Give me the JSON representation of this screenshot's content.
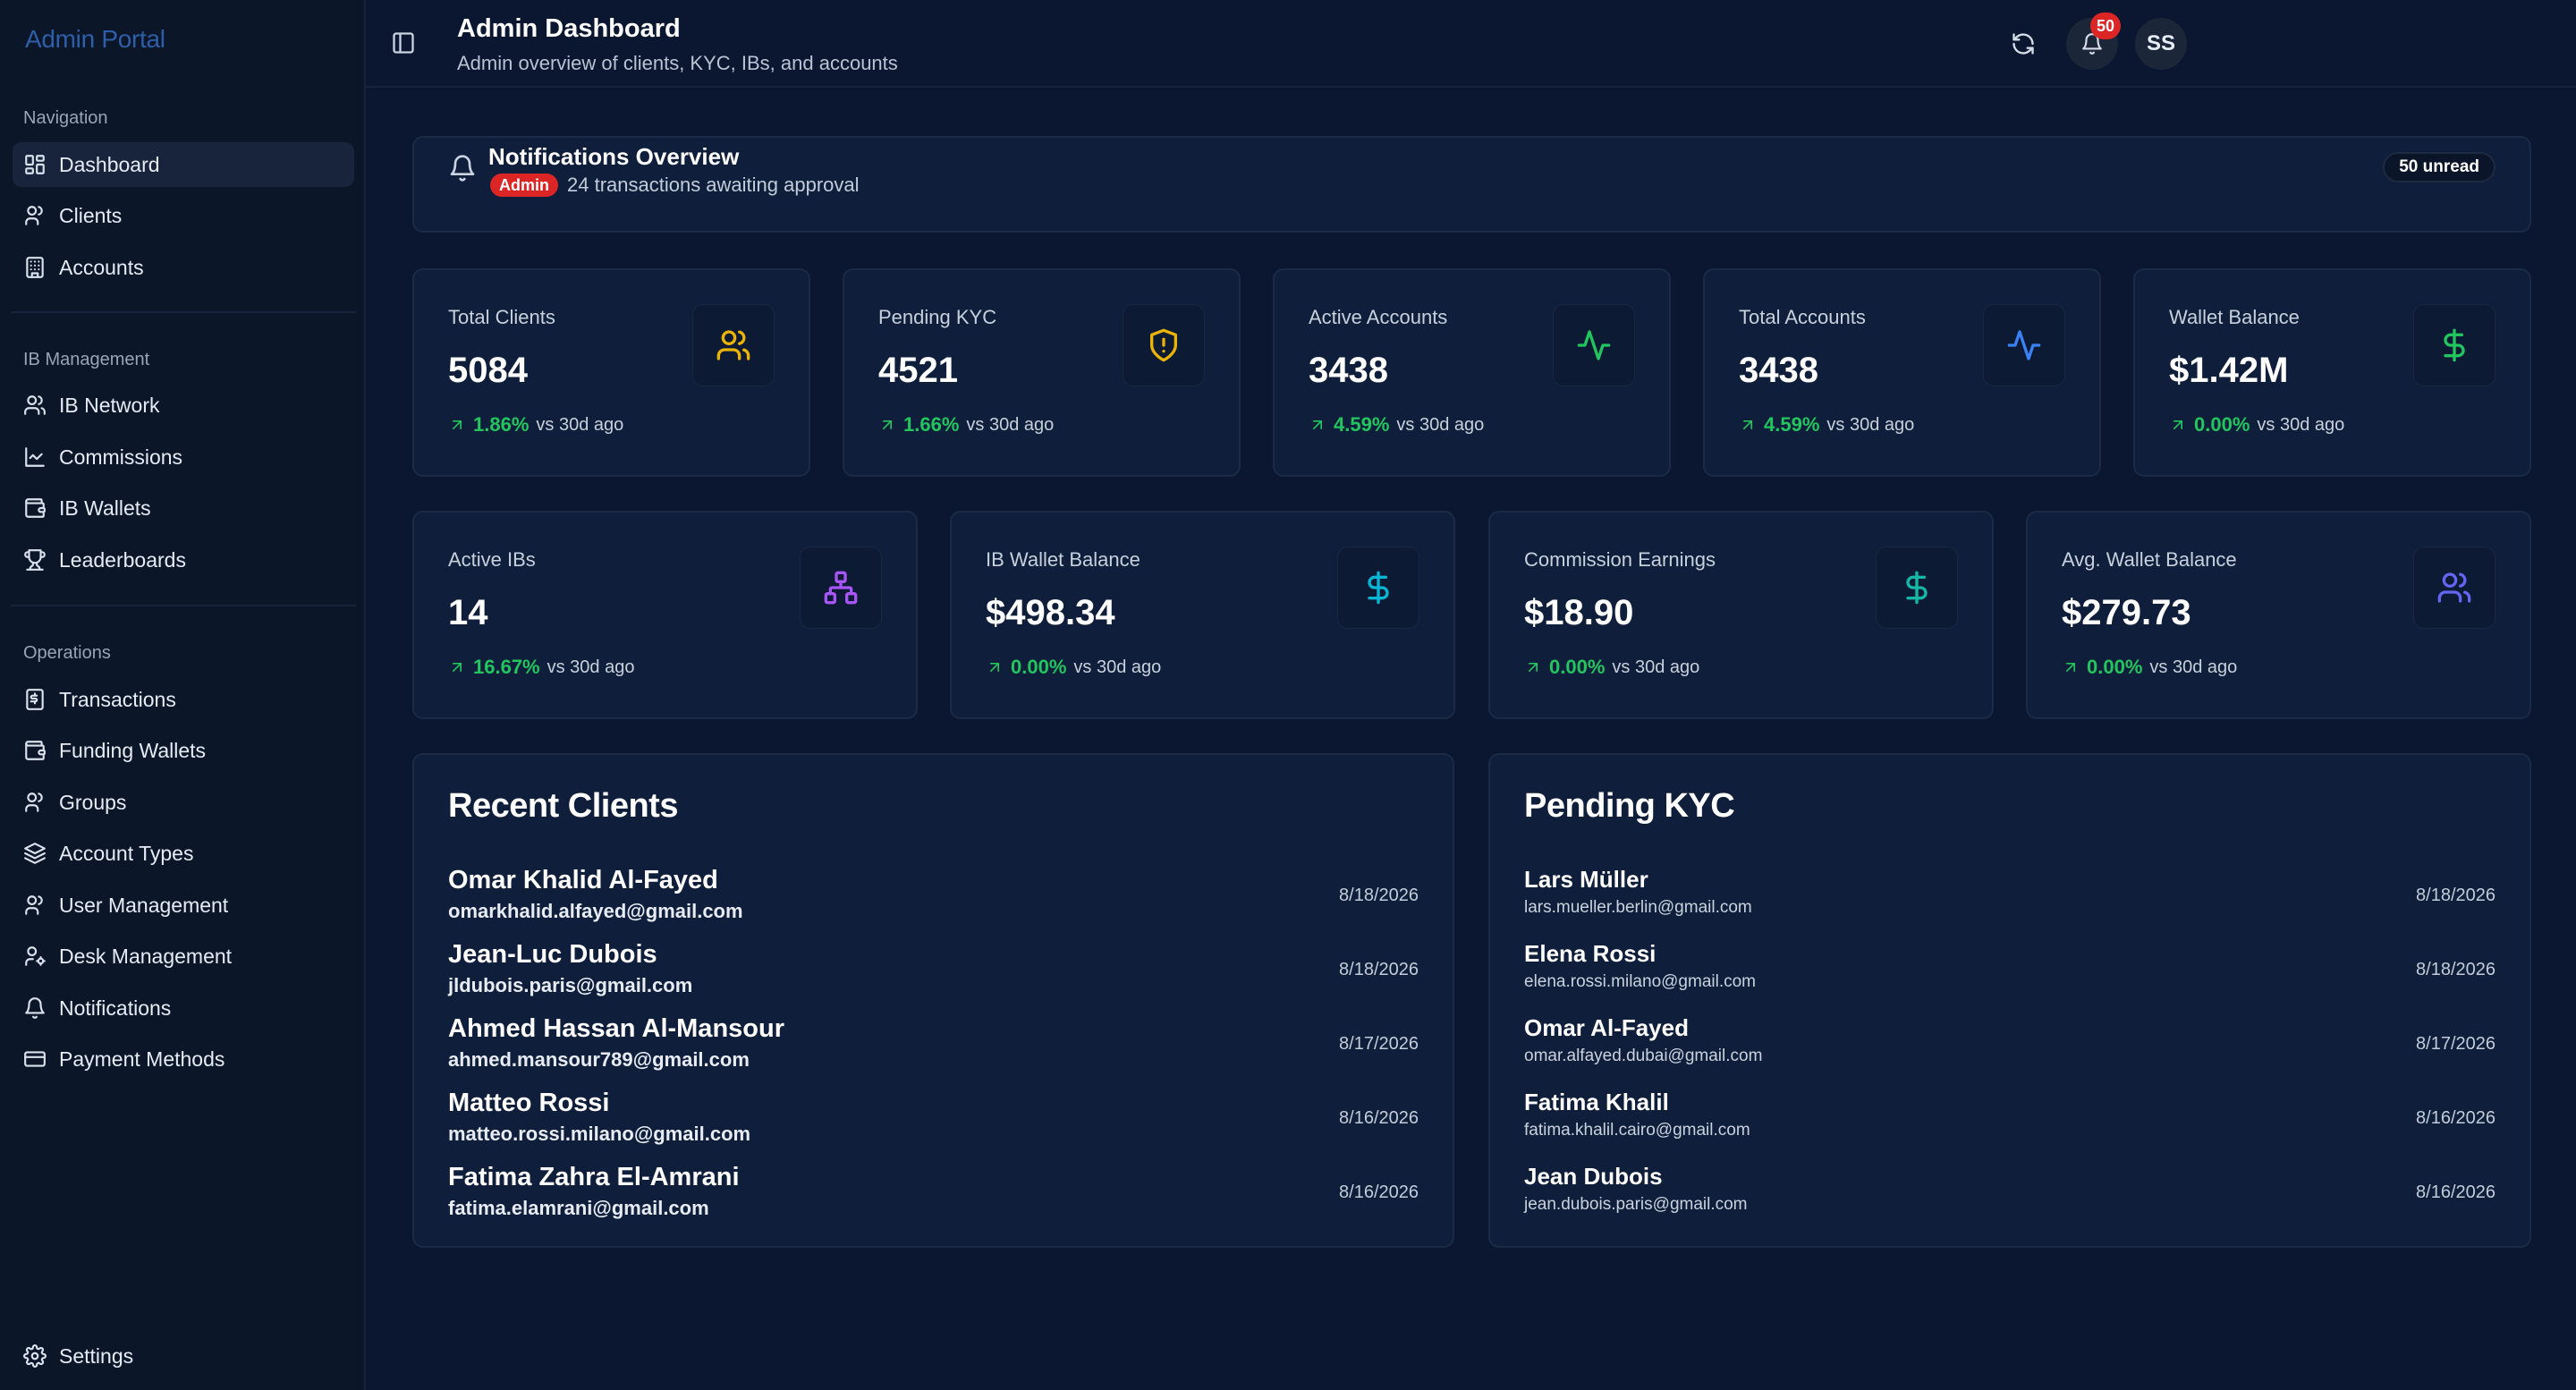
{
  "app": {
    "brand": "Admin Portal"
  },
  "header": {
    "title": "Admin Dashboard",
    "subtitle": "Admin overview of clients, KYC, IBs, and accounts",
    "notification_count": "50",
    "avatar_initials": "SS"
  },
  "sidebar": {
    "sections": [
      {
        "title": "Navigation",
        "items": [
          {
            "label": "Dashboard",
            "icon": "dashboard-icon",
            "active": true
          },
          {
            "label": "Clients",
            "icon": "user-icon"
          },
          {
            "label": "Accounts",
            "icon": "building-icon"
          }
        ]
      },
      {
        "title": "IB Management",
        "items": [
          {
            "label": "IB Network",
            "icon": "users-icon"
          },
          {
            "label": "Commissions",
            "icon": "chart-line-icon"
          },
          {
            "label": "IB Wallets",
            "icon": "wallet-icon"
          },
          {
            "label": "Leaderboards",
            "icon": "trophy-icon"
          }
        ]
      },
      {
        "title": "Operations",
        "items": [
          {
            "label": "Transactions",
            "icon": "receipt-icon"
          },
          {
            "label": "Funding Wallets",
            "icon": "wallet-icon"
          },
          {
            "label": "Groups",
            "icon": "user-icon"
          },
          {
            "label": "Account Types",
            "icon": "layers-icon"
          },
          {
            "label": "User Management",
            "icon": "user-icon"
          },
          {
            "label": "Desk Management",
            "icon": "user-cog-icon"
          },
          {
            "label": "Notifications",
            "icon": "bell-icon"
          },
          {
            "label": "Payment Methods",
            "icon": "credit-card-icon"
          }
        ]
      }
    ],
    "footer_item": {
      "label": "Settings",
      "icon": "gear-icon"
    }
  },
  "notifications": {
    "title": "Notifications Overview",
    "role_tag": "Admin",
    "message": "24 transactions awaiting approval",
    "unread": "50 unread"
  },
  "stats_row1": [
    {
      "label": "Total Clients",
      "value": "5084",
      "change": "1.86%",
      "period": "vs 30d ago",
      "icon": "users-icon",
      "color": "#eab308"
    },
    {
      "label": "Pending KYC",
      "value": "4521",
      "change": "1.66%",
      "period": "vs 30d ago",
      "icon": "shield-alert-icon",
      "color": "#eab308"
    },
    {
      "label": "Active Accounts",
      "value": "3438",
      "change": "4.59%",
      "period": "vs 30d ago",
      "icon": "activity-icon",
      "color": "#22c55e"
    },
    {
      "label": "Total Accounts",
      "value": "3438",
      "change": "4.59%",
      "period": "vs 30d ago",
      "icon": "activity-icon",
      "color": "#3b82f6"
    },
    {
      "label": "Wallet Balance",
      "value": "$1.42M",
      "change": "0.00%",
      "period": "vs 30d ago",
      "icon": "dollar-icon",
      "color": "#22c55e"
    }
  ],
  "stats_row2": [
    {
      "label": "Active IBs",
      "value": "14",
      "change": "16.67%",
      "period": "vs 30d ago",
      "icon": "network-icon",
      "color": "#a855f7"
    },
    {
      "label": "IB Wallet Balance",
      "value": "$498.34",
      "change": "0.00%",
      "period": "vs 30d ago",
      "icon": "dollar-icon",
      "color": "#06b6d4"
    },
    {
      "label": "Commission Earnings",
      "value": "$18.90",
      "change": "0.00%",
      "period": "vs 30d ago",
      "icon": "dollar-icon",
      "color": "#14b8a6"
    },
    {
      "label": "Avg. Wallet Balance",
      "value": "$279.73",
      "change": "0.00%",
      "period": "vs 30d ago",
      "icon": "users-icon",
      "color": "#6366f1"
    }
  ],
  "recent_clients": {
    "title": "Recent Clients",
    "rows": [
      {
        "name": "Omar Khalid Al-Fayed",
        "email": "omarkhalid.alfayed@gmail.com",
        "date": "8/18/2026"
      },
      {
        "name": "Jean-Luc Dubois",
        "email": "jldubois.paris@gmail.com",
        "date": "8/18/2026"
      },
      {
        "name": "Ahmed Hassan Al-Mansour",
        "email": "ahmed.mansour789@gmail.com",
        "date": "8/17/2026"
      },
      {
        "name": "Matteo Rossi",
        "email": "matteo.rossi.milano@gmail.com",
        "date": "8/16/2026"
      },
      {
        "name": "Fatima Zahra El-Amrani",
        "email": "fatima.elamrani@gmail.com",
        "date": "8/16/2026"
      }
    ]
  },
  "pending_kyc": {
    "title": "Pending KYC",
    "rows": [
      {
        "name": "Lars Müller",
        "email": "lars.mueller.berlin@gmail.com",
        "date": "8/18/2026"
      },
      {
        "name": "Elena Rossi",
        "email": "elena.rossi.milano@gmail.com",
        "date": "8/18/2026"
      },
      {
        "name": "Omar Al-Fayed",
        "email": "omar.alfayed.dubai@gmail.com",
        "date": "8/17/2026"
      },
      {
        "name": "Fatima Khalil",
        "email": "fatima.khalil.cairo@gmail.com",
        "date": "8/16/2026"
      },
      {
        "name": "Jean Dubois",
        "email": "jean.dubois.paris@gmail.com",
        "date": "8/16/2026"
      }
    ]
  }
}
